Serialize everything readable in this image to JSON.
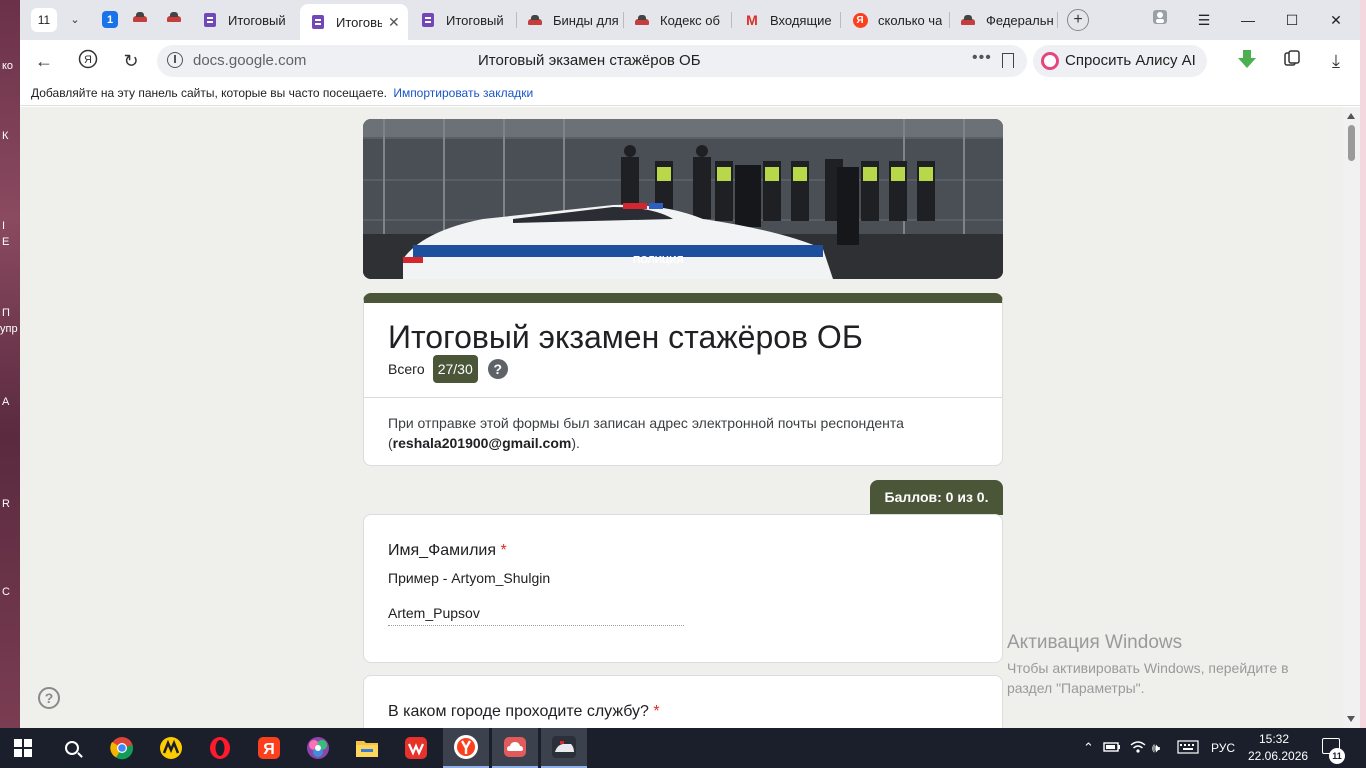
{
  "browser": {
    "tab_counter": "11",
    "pinned_badge": "1",
    "tabs": [
      {
        "label": "Итоговый",
        "icon": "forms-icon",
        "active": false
      },
      {
        "label": "Итоговы",
        "icon": "forms-icon",
        "active": true
      },
      {
        "label": "Итоговый",
        "icon": "forms-icon",
        "active": false
      },
      {
        "label": "Бинды для",
        "icon": "car-icon",
        "active": false
      },
      {
        "label": "Кодекс об",
        "icon": "car-icon",
        "active": false
      },
      {
        "label": "Входящие",
        "icon": "gmail-icon",
        "active": false
      },
      {
        "label": "сколько ча",
        "icon": "yandex-icon",
        "active": false
      },
      {
        "label": "Федеральн",
        "icon": "car-icon",
        "active": false
      }
    ],
    "omnibox": {
      "domain": "docs.google.com",
      "page_title": "Итоговый экзамен стажёров ОБ",
      "dots": "•••"
    },
    "alice_button": "Спросить Алису AI",
    "bookmarks_bar": {
      "text": "Добавляйте на эту панель сайты, которые вы часто посещаете.",
      "link": "Импортировать закладки"
    }
  },
  "form": {
    "banner_label": "ПОЛИЦИЯ",
    "title": "Итоговый экзамен стажёров ОБ",
    "total_label": "Всего",
    "score": "27/30",
    "help_glyph": "?",
    "email_note_prefix": "При отправке этой формы был записан адрес электронной почты респондента (",
    "email": "reshala201900@gmail.com",
    "email_note_suffix": ").",
    "points_tab": "Баллов: 0 из 0.",
    "questions": [
      {
        "title": "Имя_Фамилия",
        "required_mark": "*",
        "description": "Пример - Artyom_Shulgin",
        "answer": "Artem_Pupsov"
      },
      {
        "title": "В каком городе проходите службу?",
        "required_mark": "*"
      }
    ]
  },
  "windows_activation": {
    "title": "Активация Windows",
    "text": "Чтобы активировать Windows, перейдите в раздел \"Параметры\"."
  },
  "taskbar": {
    "language": "РУС",
    "time": "15:32",
    "date": "22.06.2026",
    "notification_count": "11"
  },
  "desktop_fragments": [
    "ко",
    "К",
    "I",
    "E",
    "П",
    "упр",
    "А",
    "R",
    "С"
  ],
  "colors": {
    "form_accent": "#4b5638",
    "required": "#d93025",
    "link": "#1a55c8"
  }
}
